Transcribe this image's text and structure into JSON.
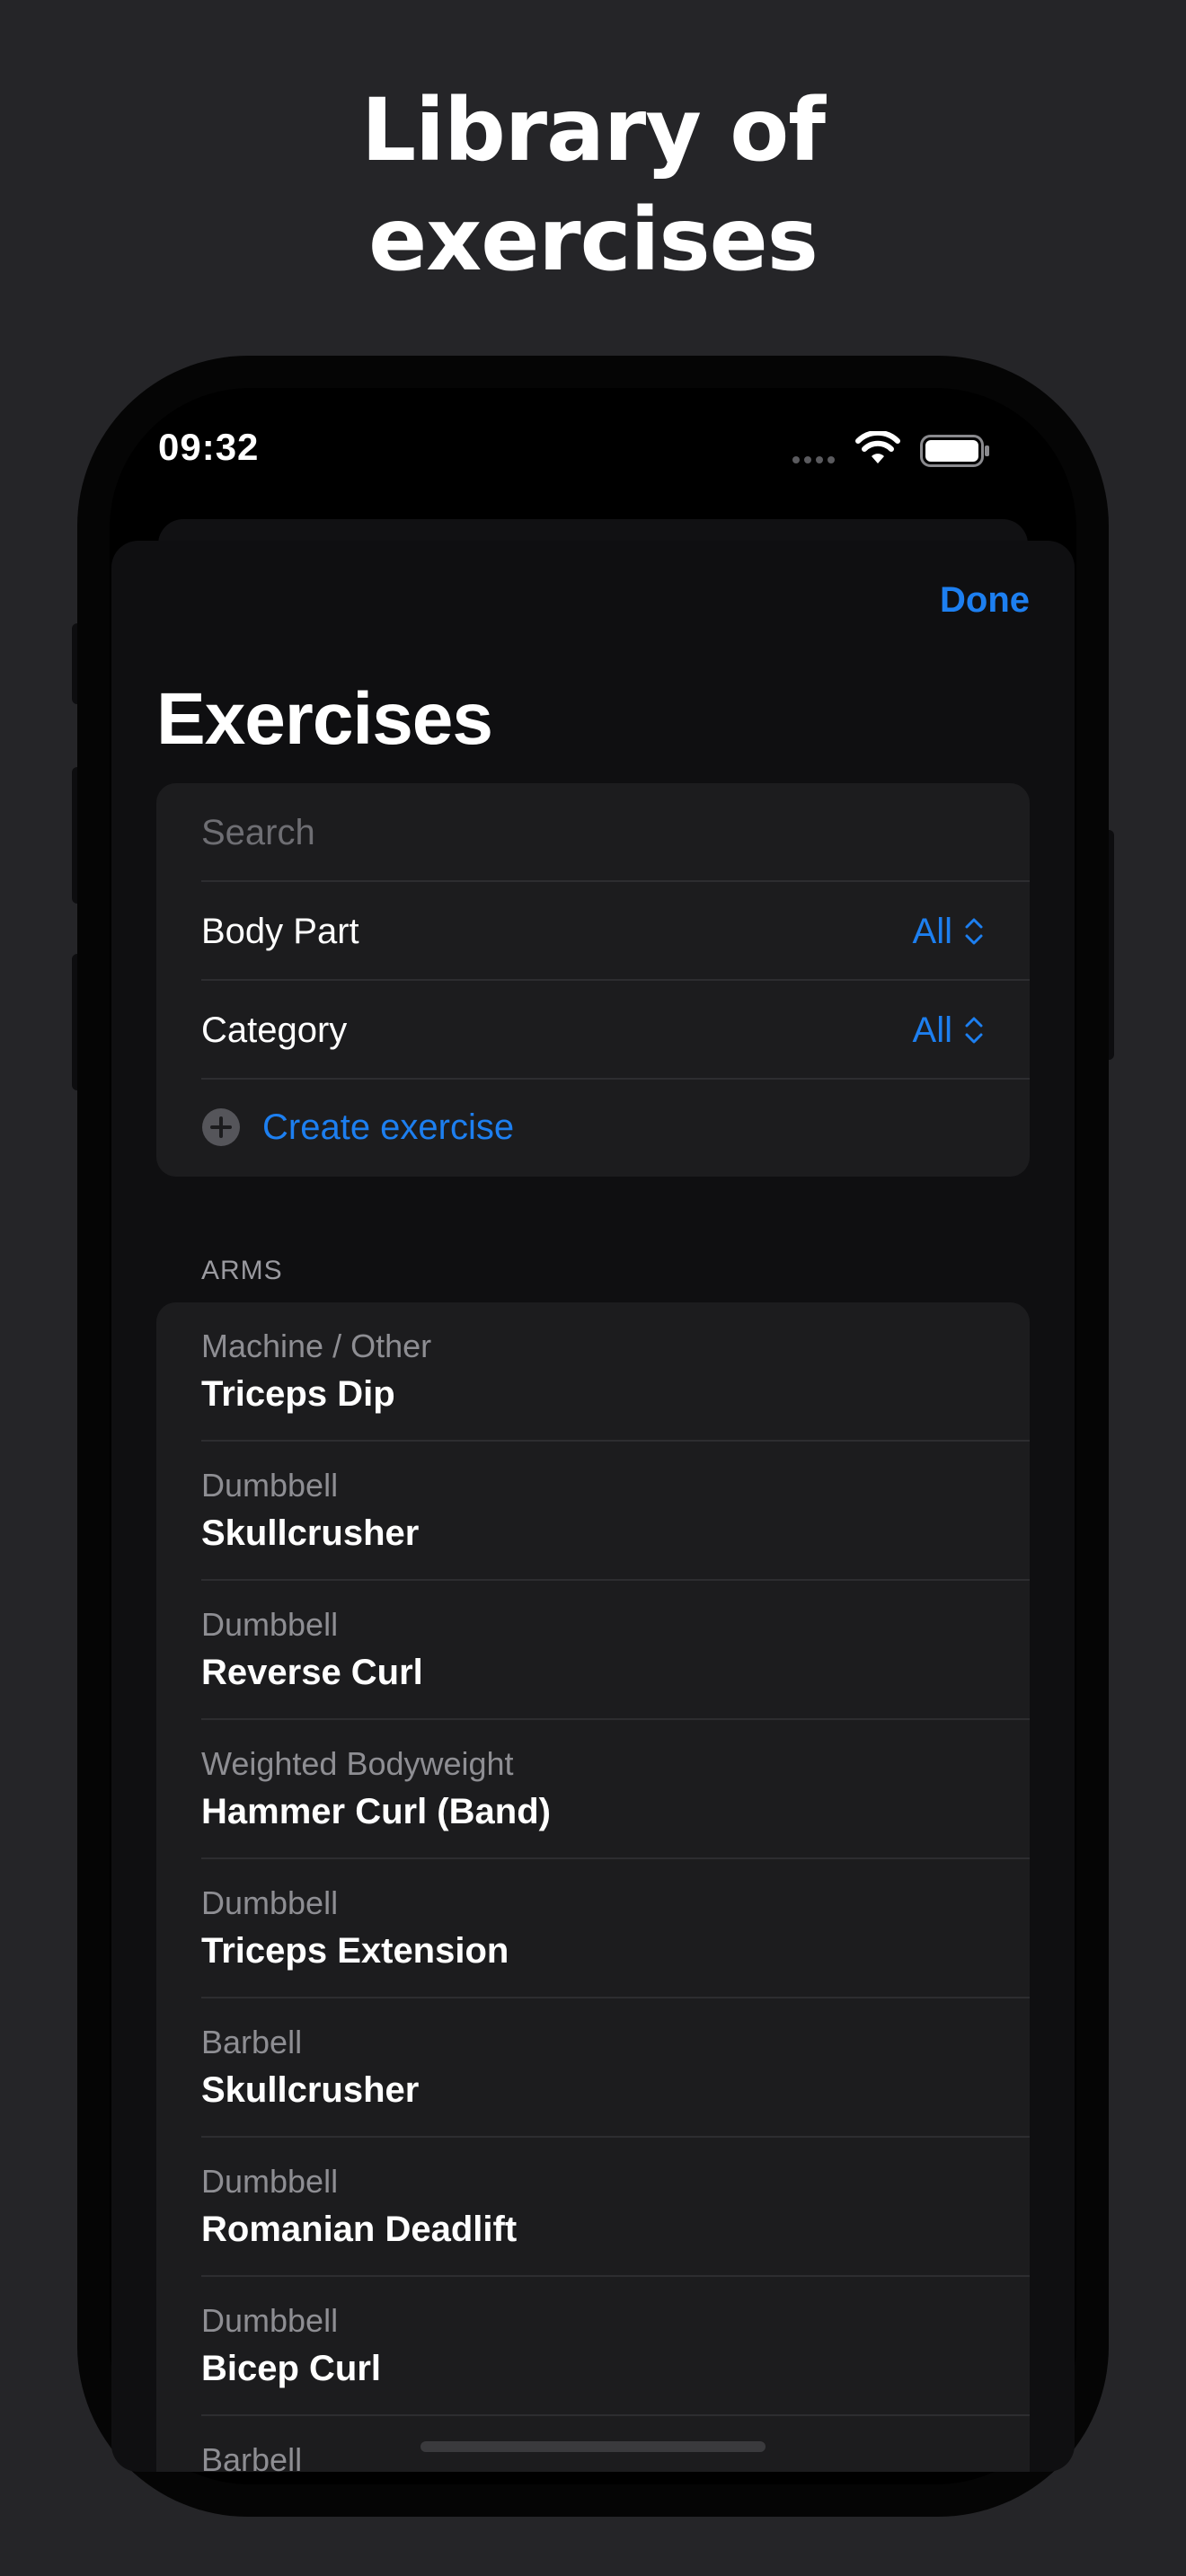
{
  "headline": {
    "line1": "Library of",
    "line2": "exercises"
  },
  "status_bar": {
    "time": "09:32"
  },
  "sheet": {
    "done_label": "Done",
    "title": "Exercises",
    "search_placeholder": "Search",
    "body_part": {
      "label": "Body Part",
      "value": "All"
    },
    "category": {
      "label": "Category",
      "value": "All"
    },
    "create_label": "Create exercise"
  },
  "section": {
    "header": "ARMS"
  },
  "exercises": [
    {
      "category": "Machine / Other",
      "name": "Triceps Dip"
    },
    {
      "category": "Dumbbell",
      "name": "Skullcrusher"
    },
    {
      "category": "Dumbbell",
      "name": "Reverse Curl"
    },
    {
      "category": "Weighted Bodyweight",
      "name": "Hammer Curl (Band)"
    },
    {
      "category": "Dumbbell",
      "name": "Triceps Extension"
    },
    {
      "category": "Barbell",
      "name": "Skullcrusher"
    },
    {
      "category": "Dumbbell",
      "name": "Romanian Deadlift"
    },
    {
      "category": "Dumbbell",
      "name": "Bicep Curl"
    },
    {
      "category": "Barbell",
      "name": ""
    }
  ],
  "colors": {
    "accent": "#1d7ff0",
    "background": "#252528",
    "card": "#1c1c1e"
  }
}
